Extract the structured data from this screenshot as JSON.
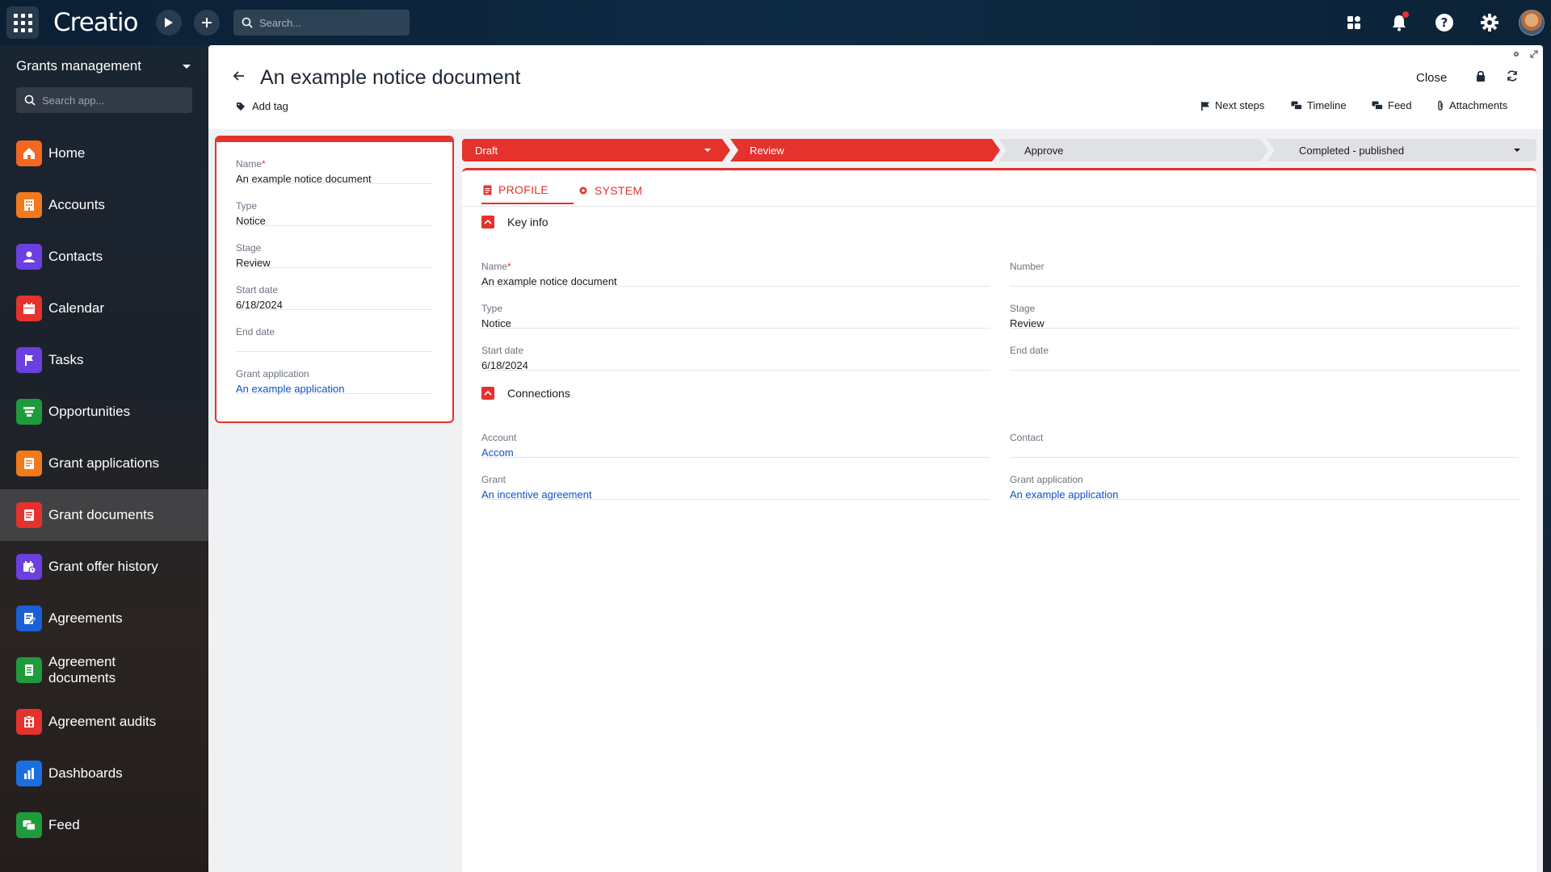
{
  "topbar": {
    "logo": "Creatio",
    "search_placeholder": "Search..."
  },
  "sidebar": {
    "workspace": "Grants management",
    "search_placeholder": "Search app...",
    "items": [
      {
        "label": "Home",
        "color": "#f26722"
      },
      {
        "label": "Accounts",
        "color": "#f27a1a"
      },
      {
        "label": "Contacts",
        "color": "#6c3fe0"
      },
      {
        "label": "Calendar",
        "color": "#e5322d"
      },
      {
        "label": "Tasks",
        "color": "#6c3fe0"
      },
      {
        "label": "Opportunities",
        "color": "#1e9b3b"
      },
      {
        "label": "Grant applications",
        "color": "#f27a1a"
      },
      {
        "label": "Grant documents",
        "color": "#e5322d"
      },
      {
        "label": "Grant offer history",
        "color": "#6c3fe0"
      },
      {
        "label": "Agreements",
        "color": "#1a5fd6"
      },
      {
        "label": "Agreement documents",
        "color": "#1e9b3b"
      },
      {
        "label": "Agreement audits",
        "color": "#e5322d"
      },
      {
        "label": "Dashboards",
        "color": "#1a6fe0"
      },
      {
        "label": "Feed",
        "color": "#1e9b3b"
      }
    ],
    "active_item": "Grant documents"
  },
  "header": {
    "title": "An example notice document",
    "add_tag": "Add tag",
    "close": "Close",
    "actions": {
      "next_steps": "Next steps",
      "timeline": "Timeline",
      "feed": "Feed",
      "attachments": "Attachments"
    }
  },
  "left_card": {
    "fields": [
      {
        "label": "Name",
        "value": "An example notice document",
        "required": "*"
      },
      {
        "label": "Type",
        "value": "Notice"
      },
      {
        "label": "Stage",
        "value": "Review"
      },
      {
        "label": "Start date",
        "value": "6/18/2024"
      },
      {
        "label": "End date",
        "value": ""
      },
      {
        "label": "Grant application",
        "value": "An example application"
      }
    ]
  },
  "stages": [
    {
      "label": "Draft",
      "state": "done"
    },
    {
      "label": "Review",
      "state": "current"
    },
    {
      "label": "Approve",
      "state": "todo"
    },
    {
      "label": "Completed - published",
      "state": "todo"
    }
  ],
  "tabs": {
    "profile": "PROFILE",
    "system": "SYSTEM"
  },
  "key_info": {
    "title": "Key info",
    "name_label": "Name",
    "name_required": "*",
    "name_value": "An example notice document",
    "number_label": "Number",
    "number_value": "",
    "type_label": "Type",
    "type_value": "Notice",
    "stage_label": "Stage",
    "stage_value": "Review",
    "start_label": "Start date",
    "start_value": "6/18/2024",
    "end_label": "End date",
    "end_value": ""
  },
  "connections": {
    "title": "Connections",
    "account_label": "Account",
    "account_value": "Accom",
    "contact_label": "Contact",
    "contact_value": "",
    "grant_label": "Grant",
    "grant_value": "An incentive agreement",
    "grant_app_label": "Grant application",
    "grant_app_value": "An example application"
  },
  "colors": {
    "accent": "#e5322d",
    "link": "#0d52c7"
  }
}
